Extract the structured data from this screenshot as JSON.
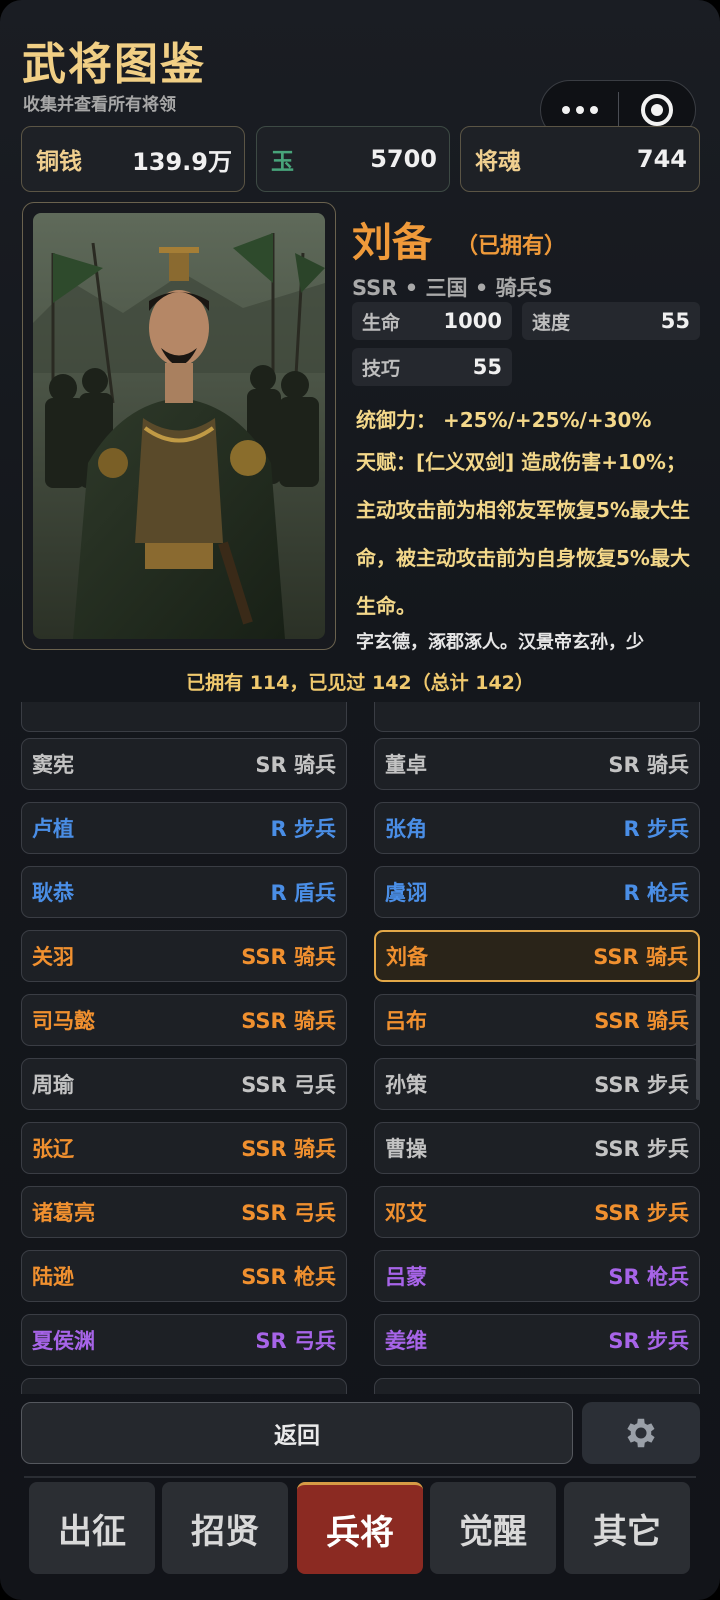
{
  "header": {
    "title": "武将图鉴",
    "subtitle": "收集并查看所有将领"
  },
  "resources": [
    {
      "label": "铜钱",
      "value": "139.9万"
    },
    {
      "label": "玉",
      "value": "5700"
    },
    {
      "label": "将魂",
      "value": "744"
    }
  ],
  "hero": {
    "name": "刘备",
    "owned_tag": "（已拥有）",
    "meta": "SSR • 三国 • 骑兵S",
    "stats": {
      "hp_label": "生命",
      "hp": "1000",
      "speed_label": "速度",
      "speed": "55",
      "skill_label": "技巧",
      "skill": "55"
    },
    "command": "统御力：  +25%/+25%/+30%",
    "talent": "天赋：[仁义双剑] 造成伤害+10%；主动攻击前为相邻友军恢复5%最大生命，被主动攻击前为自身恢复5%最大生命。",
    "bio": "字玄德，涿郡涿人。汉景帝玄孙，少"
  },
  "summary": "已拥有 114，已见过 142（总计 142）",
  "generals": [
    {
      "name": "窦宪",
      "tag": "SR 骑兵",
      "cls": "c-gray"
    },
    {
      "name": "董卓",
      "tag": "SR 骑兵",
      "cls": "c-gray"
    },
    {
      "name": "卢植",
      "tag": "R 步兵",
      "cls": "c-r"
    },
    {
      "name": "张角",
      "tag": "R 步兵",
      "cls": "c-r"
    },
    {
      "name": "耿恭",
      "tag": "R 盾兵",
      "cls": "c-r"
    },
    {
      "name": "虞诩",
      "tag": "R 枪兵",
      "cls": "c-r"
    },
    {
      "name": "关羽",
      "tag": "SSR 骑兵",
      "cls": "c-ssr"
    },
    {
      "name": "刘备",
      "tag": "SSR 骑兵",
      "cls": "c-ssr"
    },
    {
      "name": "司马懿",
      "tag": "SSR 骑兵",
      "cls": "c-ssr"
    },
    {
      "name": "吕布",
      "tag": "SSR 骑兵",
      "cls": "c-ssr"
    },
    {
      "name": "周瑜",
      "tag": "SSR 弓兵",
      "cls": "c-gray"
    },
    {
      "name": "孙策",
      "tag": "SSR 步兵",
      "cls": "c-gray"
    },
    {
      "name": "张辽",
      "tag": "SSR 骑兵",
      "cls": "c-ssr"
    },
    {
      "name": "曹操",
      "tag": "SSR 步兵",
      "cls": "c-gray"
    },
    {
      "name": "诸葛亮",
      "tag": "SSR 弓兵",
      "cls": "c-ssr"
    },
    {
      "name": "邓艾",
      "tag": "SSR 步兵",
      "cls": "c-ssr"
    },
    {
      "name": "陆逊",
      "tag": "SSR 枪兵",
      "cls": "c-ssr"
    },
    {
      "name": "吕蒙",
      "tag": "SR 枪兵",
      "cls": "c-sr"
    },
    {
      "name": "夏侯渊",
      "tag": "SR 弓兵",
      "cls": "c-sr"
    },
    {
      "name": "姜维",
      "tag": "SR 步兵",
      "cls": "c-sr"
    }
  ],
  "selected_general": "刘备",
  "footer": {
    "back_label": "返回"
  },
  "tabs": [
    {
      "label": "出征",
      "active": false
    },
    {
      "label": "招贤",
      "active": false
    },
    {
      "label": "兵将",
      "active": true
    },
    {
      "label": "觉醒",
      "active": false
    },
    {
      "label": "其它",
      "active": false
    }
  ],
  "colors": {
    "ssr": "#f0902f",
    "sr": "#a764e8",
    "r": "#4a8ee6",
    "gold": "#f1cf85"
  }
}
